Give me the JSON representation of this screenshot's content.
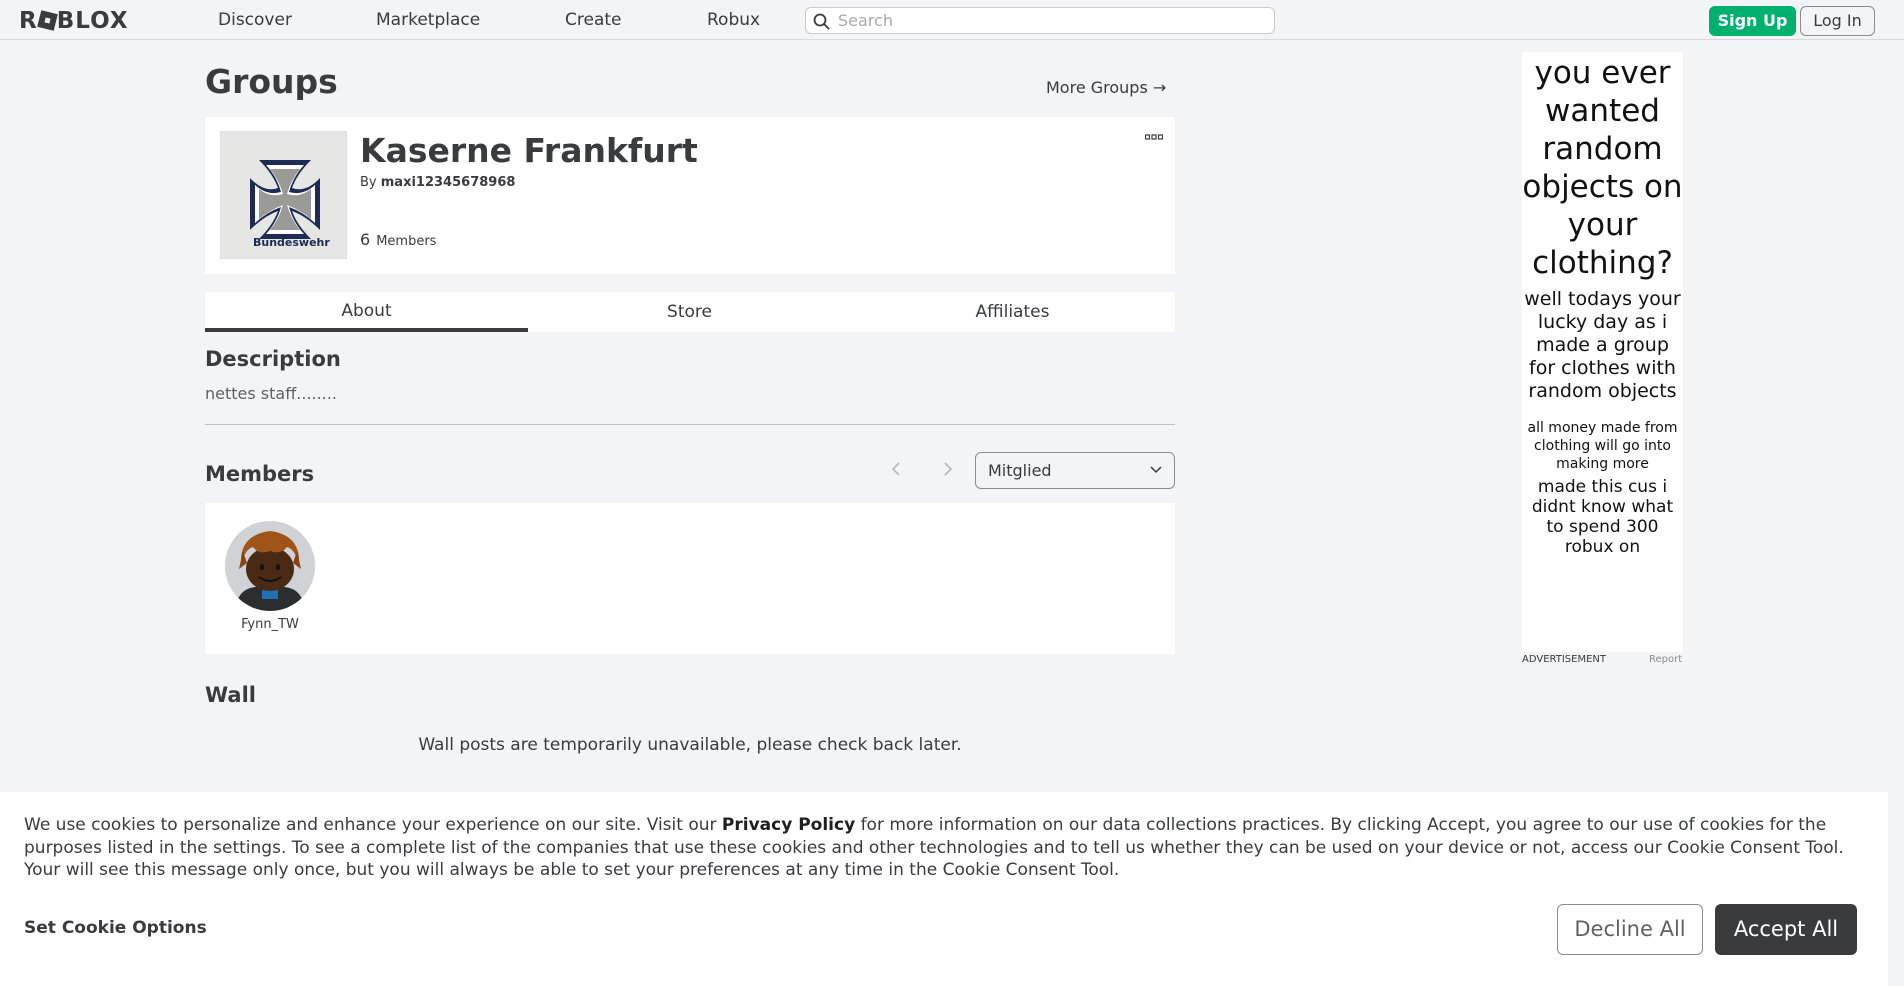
{
  "header": {
    "logo": "ROBLOX",
    "nav": [
      "Discover",
      "Marketplace",
      "Create",
      "Robux"
    ],
    "search_placeholder": "Search",
    "signup_label": "Sign Up",
    "login_label": "Log In"
  },
  "page": {
    "title": "Groups",
    "more_groups": "More Groups →"
  },
  "group": {
    "name": "Kaserne Frankfurt",
    "by_label": "By",
    "owner": "maxi12345678968",
    "member_count": "6",
    "members_label": "Members",
    "emblem_brand": "Bundeswehr"
  },
  "tabs": [
    "About",
    "Store",
    "Affiliates"
  ],
  "about": {
    "description_heading": "Description",
    "description": "nettes staff........",
    "members_heading": "Members",
    "role_selected": "Mitglied",
    "members": [
      {
        "name": "Fynn_TW"
      }
    ],
    "wall_heading": "Wall",
    "wall_message": "Wall posts are temporarily unavailable, please check back later."
  },
  "ad": {
    "line1": "you ever wanted random objects on your clothing?",
    "line2": "well todays your lucky day as i made a group for clothes with random objects",
    "line3": "all money made from clothing will go into making more",
    "line4": "made this cus i didnt know what to spend 300 robux on",
    "label": "ADVERTISEMENT",
    "report": "Report"
  },
  "cookie": {
    "text_before": "We use cookies to personalize and enhance your experience on our site. Visit our ",
    "policy_link": "Privacy Policy",
    "text_after": " for more information on our data collections practices. By clicking Accept, you agree to our use of cookies for the purposes listed in the settings. To see a complete list of the companies that use these cookies and other technologies and to tell us whether they can be used on your device or not, access our Cookie Consent Tool. Your will see this message only once, but you will always be able to set your preferences at any time in the Cookie Consent Tool.",
    "options_label": "Set Cookie Options",
    "decline_label": "Decline All",
    "accept_label": "Accept All"
  },
  "colors": {
    "accent_green": "#00b06f",
    "dark": "#393b3d",
    "background": "#f2f4f5"
  },
  "icons": [
    "search-icon",
    "arrow-right-icon",
    "more-options-icon",
    "chevron-left-icon",
    "chevron-right-icon",
    "chevron-down-icon"
  ]
}
